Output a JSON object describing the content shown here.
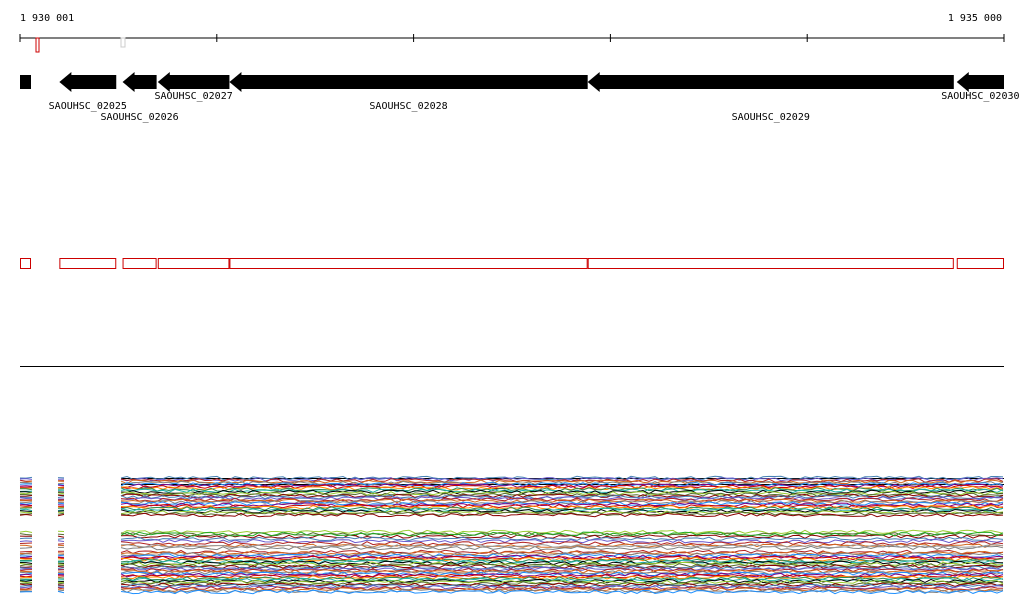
{
  "axis": {
    "start_label": "1 930 001",
    "end_label": "1 935 000",
    "start": 1930001,
    "end": 1935000
  },
  "genes": [
    {
      "id": "SAOUHSC_02025",
      "start": 1930201,
      "end": 1930490,
      "strand": "-",
      "label_row": 1
    },
    {
      "id": "SAOUHSC_02026",
      "start": 1930522,
      "end": 1930695,
      "strand": "-",
      "label_row": 2
    },
    {
      "id": "SAOUHSC_02027",
      "start": 1930701,
      "end": 1931065,
      "strand": "-",
      "label_row": 0
    },
    {
      "id": "SAOUHSC_02028",
      "start": 1931065,
      "end": 1932885,
      "strand": "-",
      "label_row": 1
    },
    {
      "id": "SAOUHSC_02029",
      "start": 1932885,
      "end": 1934745,
      "strand": "-",
      "label_row": 2
    },
    {
      "id": "SAOUHSC_02030",
      "start": 1934760,
      "end": 1935000,
      "strand": "-",
      "label_row": 0
    }
  ],
  "colors": {
    "gene": "#000000",
    "annotation_box": "#cc0000",
    "axis": "#000000",
    "tracks": [
      "#000000",
      "#2e8b57",
      "#cc0000",
      "#1e90ff",
      "#d2691e",
      "#6a5acd",
      "#8b0000",
      "#9acd32",
      "#20b2aa",
      "#ff8c00",
      "#800080",
      "#808080",
      "#b22222",
      "#4682b4",
      "#556b2f"
    ]
  }
}
